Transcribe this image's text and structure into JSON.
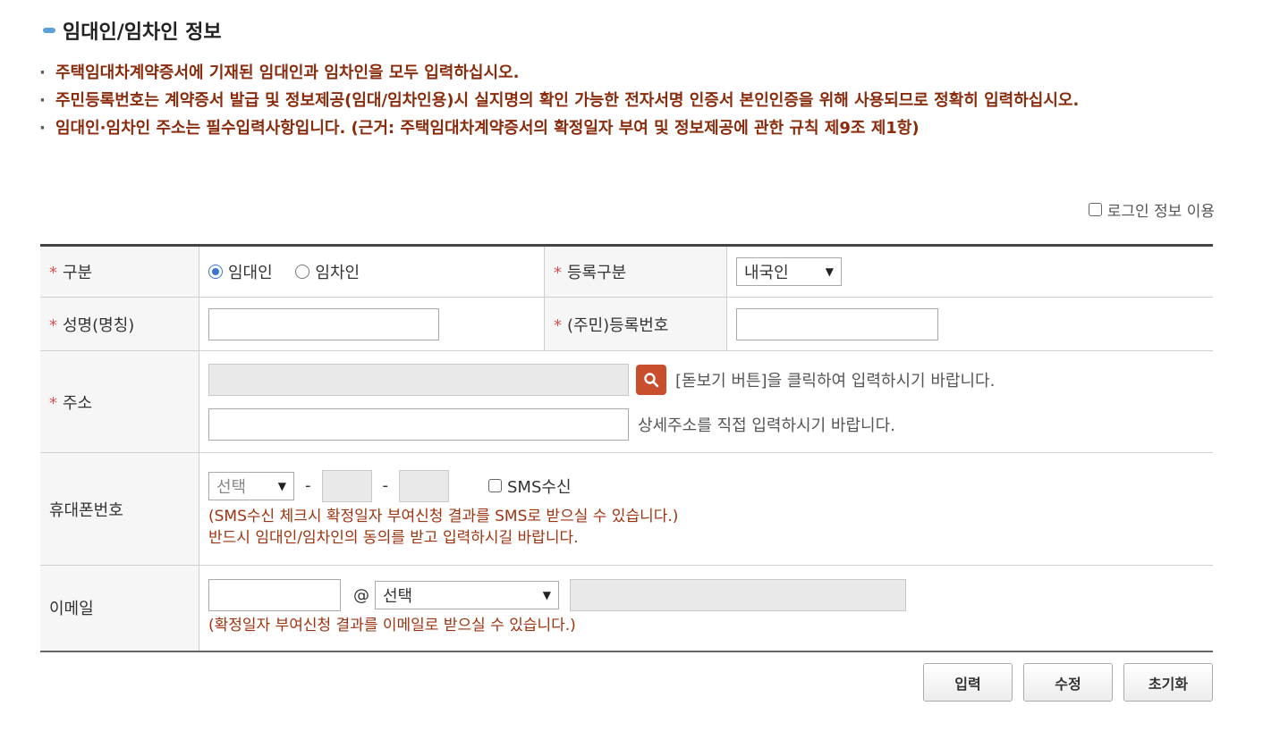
{
  "section": {
    "title": "임대인/임차인 정보"
  },
  "notes": [
    "주택임대차계약증서에 기재된 임대인과 임차인을 모두 입력하십시오.",
    "주민등록번호는 계약증서 발급 및 정보제공(임대/임차인용)시 실지명의 확인 가능한 전자서명 인증서 본인인증을 위해 사용되므로 정확히 입력하십시오.",
    "임대인·임차인 주소는 필수입력사항입니다. (근거: 주택임대차계약증서의 확정일자 부여 및 정보제공에 관한 규칙 제9조 제1항)"
  ],
  "login_option": "로그인 정보 이용",
  "form": {
    "required_mark": "*",
    "type": {
      "label": "구분",
      "options": [
        "임대인",
        "임차인"
      ],
      "selected": "임대인"
    },
    "reg_type": {
      "label": "등록구분",
      "value": "내국인"
    },
    "name": {
      "label": "성명(명칭)",
      "value": ""
    },
    "reg_no": {
      "label": "(주민)등록번호",
      "value": ""
    },
    "address": {
      "label": "주소",
      "search_hint": "[돋보기 버튼]을 클릭하여 입력하시기 바랍니다.",
      "detail_hint": "상세주소를 직접 입력하시기 바랍니다."
    },
    "phone": {
      "label": "휴대폰번호",
      "prefix": "선택",
      "dash": "-",
      "sms_label": "SMS수신",
      "note1": "(SMS수신 체크시 확정일자 부여신청 결과를 SMS로 받으실 수 있습니다.)",
      "note2": "반드시 임대인/임차인의 동의를 받고 입력하시길 바랍니다."
    },
    "email": {
      "label": "이메일",
      "at": "@",
      "domain_select": "선택",
      "note": "(확정일자 부여신청 결과를 이메일로 받으실 수 있습니다.)"
    }
  },
  "buttons": {
    "input": "입력",
    "edit": "수정",
    "reset": "초기화"
  },
  "colors": {
    "required": "#d9534f",
    "note_text": "#8a2b0c",
    "search_button": "#c94e2e",
    "radio_on": "#3a74d6"
  }
}
